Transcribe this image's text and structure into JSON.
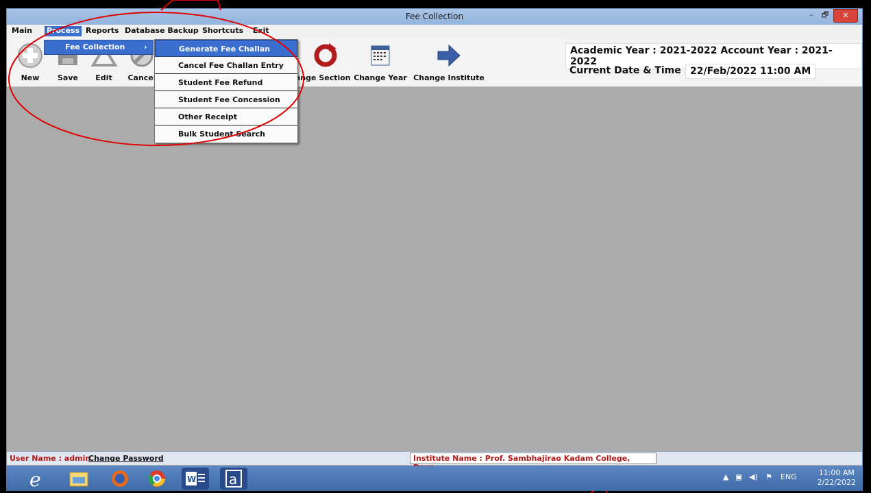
{
  "window": {
    "title": "Fee Collection",
    "min": "–",
    "max": "🗗",
    "close": "✕"
  },
  "menubar": [
    "Main",
    "Process",
    "Reports",
    "Database Backup",
    "Shortcuts",
    "Exit"
  ],
  "toolbar": {
    "new": "New",
    "save": "Save",
    "edit": "Edit",
    "cancel": "Cancel",
    "change_section": "Change Section",
    "change_year": "Change Year",
    "change_institute": "Change Institute"
  },
  "info": {
    "years": "Academic Year : 2021-2022 Account Year : 2021-2022",
    "datetime_label": "Current Date & Time :",
    "datetime_value": "22/Feb/2022 11:00 AM"
  },
  "process_menu": {
    "fee_collection": "Fee Collection",
    "arrow": "›"
  },
  "fee_submenu": [
    "Generate Fee Challan",
    "Cancel Fee Challan Entry",
    "Student Fee Refund",
    "Student Fee Concession",
    "Other Receipt",
    "Bulk Student Search"
  ],
  "status": {
    "user": "User Name : admin",
    "change_password": "Change Password",
    "institute": "Institute Name : Prof. Sambhajirao Kadam College, Deur"
  },
  "taskbar": {
    "lang": "ENG",
    "time": "11:00 AM",
    "date": "2/22/2022"
  },
  "colors": {
    "accent": "#3a6fd0",
    "status_red": "#b01818",
    "annotation_red": "#e00000"
  }
}
